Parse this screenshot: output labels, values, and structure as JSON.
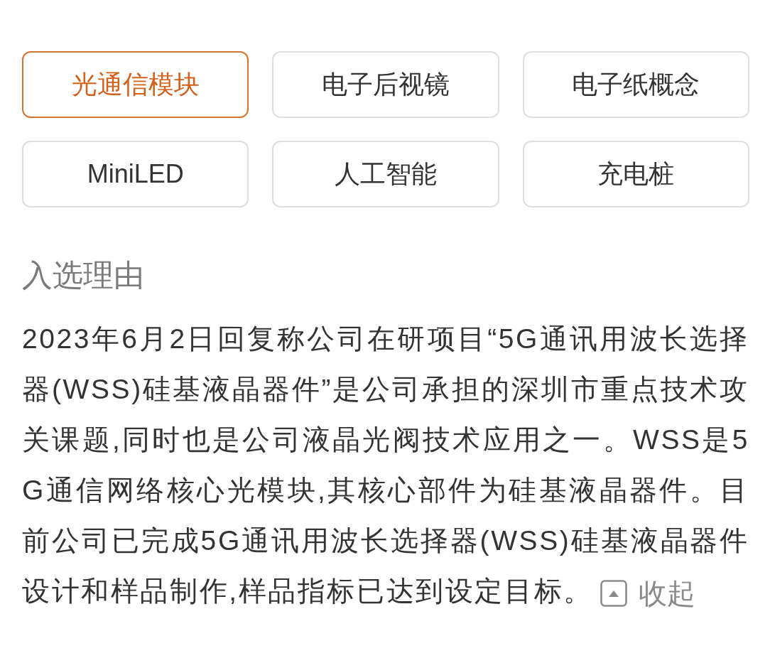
{
  "concept_tags": [
    {
      "label": "光通信模块",
      "selected": true
    },
    {
      "label": "电子后视镜",
      "selected": false
    },
    {
      "label": "电子纸概念",
      "selected": false
    },
    {
      "label": "MiniLED",
      "selected": false
    },
    {
      "label": "人工智能",
      "selected": false
    },
    {
      "label": "充电桩",
      "selected": false
    }
  ],
  "reason": {
    "heading": "入选理由",
    "text": "2023年6月2日回复称公司在研项目“5G通讯用波长选择器(WSS)硅基液晶器件”是公司承担的深圳市重点技术攻关课题,同时也是公司液晶光阀技术应用之一。WSS是5G通信网络核心光模块,其核心部件为硅基液晶器件。目前公司已完成5G通讯用波长选择器(WSS)硅基液晶器件设计和样品制作,样品指标已达到设定目标。",
    "collapse_label": "收起"
  }
}
